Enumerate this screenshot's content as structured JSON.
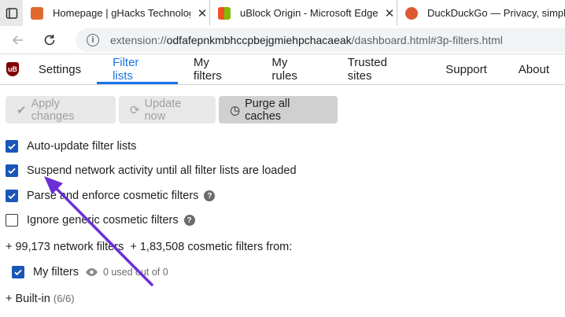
{
  "browser": {
    "tabs": [
      {
        "title": "Homepage | gHacks Technology News",
        "close": "✕"
      },
      {
        "title": "uBlock Origin - Microsoft Edge Add-ons",
        "close": "✕"
      },
      {
        "title": "DuckDuckGo — Privacy, simplified."
      }
    ],
    "url": {
      "scheme": "extension://",
      "host": "odfafepnkmbhccpbejgmiehpchacaeak",
      "path": "/dashboard.html#3p-filters.html"
    }
  },
  "nav": {
    "logo": "uB",
    "tabs": [
      "Settings",
      "Filter lists",
      "My filters",
      "My rules",
      "Trusted sites",
      "Support",
      "About"
    ],
    "active": "Filter lists"
  },
  "toolbar": {
    "apply": "Apply changes",
    "update": "Update now",
    "purge": "Purge all caches"
  },
  "options": [
    {
      "label": "Auto-update filter lists",
      "checked": true
    },
    {
      "label": "Suspend network activity until all filter lists are loaded",
      "checked": true
    },
    {
      "label": "Parse and enforce cosmetic filters",
      "checked": true,
      "help": "?"
    },
    {
      "label": "Ignore generic cosmetic filters",
      "checked": false,
      "help": "?"
    }
  ],
  "summary": {
    "network_prefix": "+ 99,173 network filters",
    "cosmetic": "+ 1,83,508 cosmetic filters from:"
  },
  "my_filters": {
    "label": "My filters",
    "usage": "0 used out of 0"
  },
  "builtin": {
    "label": "+ Built-in",
    "count": "(6/6)"
  },
  "colors": {
    "accent": "#1a73e8",
    "checkbox": "#1a56b8",
    "arrow": "#6b2fd6"
  }
}
